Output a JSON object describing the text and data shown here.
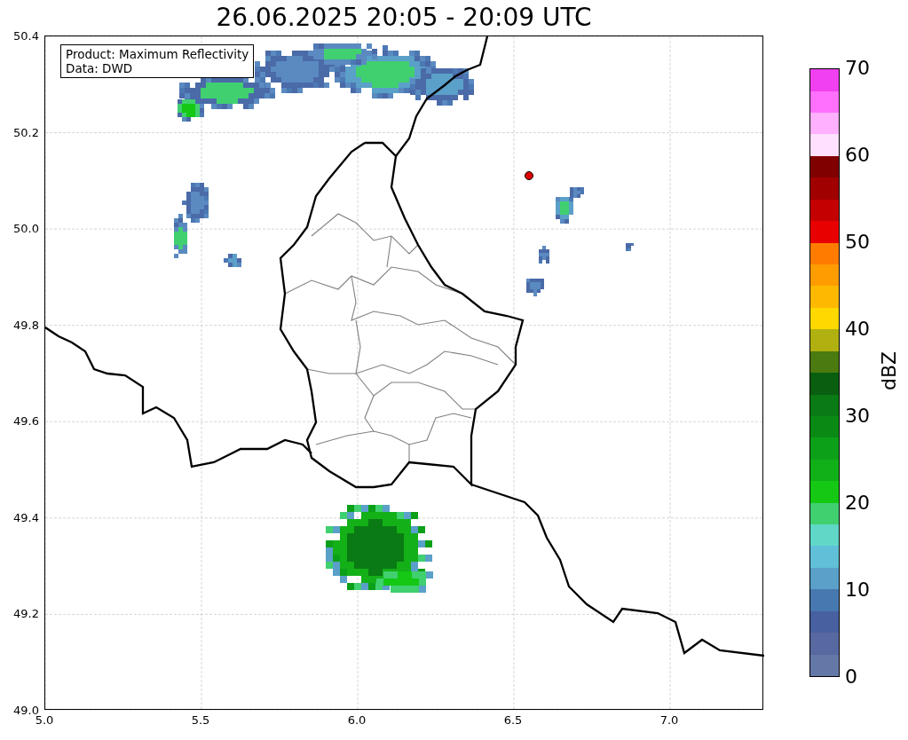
{
  "title": "26.06.2025 20:05 - 20:09 UTC",
  "map": {
    "info_box": [
      "Product: Maximum Reflectivity",
      "Data: DWD"
    ],
    "x_ticks": [
      "5.0",
      "5.5",
      "6.0",
      "6.5",
      "7.0"
    ],
    "y_ticks": [
      "50.4",
      "50.2",
      "50.0",
      "49.8",
      "49.6",
      "49.4",
      "49.2",
      "49.0"
    ]
  },
  "colorbar": {
    "label": "dBZ",
    "ticks": [
      "70",
      "60",
      "50",
      "40",
      "30",
      "20",
      "10",
      "0"
    ],
    "segments": [
      {
        "color": "#6478a8"
      },
      {
        "color": "#5868a0"
      },
      {
        "color": "#4860a0"
      },
      {
        "color": "#4878b0"
      },
      {
        "color": "#5aa0c8"
      },
      {
        "color": "#60c0d8"
      },
      {
        "color": "#60d8c8"
      },
      {
        "color": "#40d070"
      },
      {
        "color": "#14c814"
      },
      {
        "color": "#10b018"
      },
      {
        "color": "#0ca018"
      },
      {
        "color": "#0a8a14"
      },
      {
        "color": "#0a7a14"
      },
      {
        "color": "#0a5e10"
      },
      {
        "color": "#4a7a10"
      },
      {
        "color": "#b0b010"
      },
      {
        "color": "#ffd800"
      },
      {
        "color": "#ffb800"
      },
      {
        "color": "#ff9c00"
      },
      {
        "color": "#ff7c00"
      },
      {
        "color": "#e80000"
      },
      {
        "color": "#c40000"
      },
      {
        "color": "#a00000"
      },
      {
        "color": "#800000"
      },
      {
        "color": "#ffe0ff"
      },
      {
        "color": "#ffb0ff"
      },
      {
        "color": "#ff70ff"
      },
      {
        "color": "#f040f0"
      }
    ]
  }
}
